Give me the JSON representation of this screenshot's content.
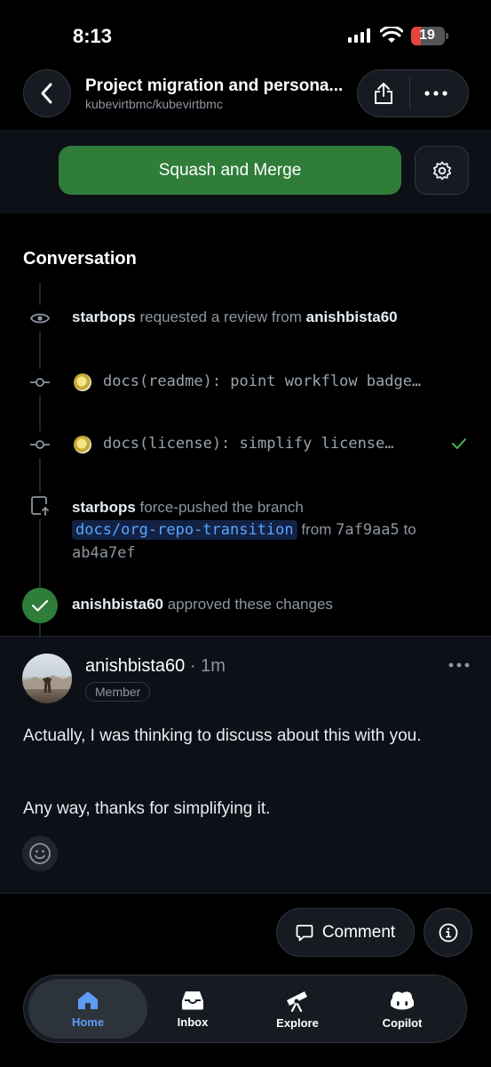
{
  "status_bar": {
    "time": "8:13",
    "battery": "19"
  },
  "header": {
    "title": "Project migration and persona...",
    "subtitle": "kubevirtbmc/kubevirtbmc"
  },
  "merge": {
    "button_label": "Squash and Merge"
  },
  "conversation": {
    "title": "Conversation",
    "review_request": {
      "actor": "starbops",
      "action": " requested a review from ",
      "target": "anishbista60"
    },
    "commits": [
      {
        "message": "docs(readme): point workflow badge…"
      },
      {
        "message": "docs(license): simplify license…"
      }
    ],
    "force_push": {
      "actor": "starbops",
      "action": " force-pushed the branch",
      "branch": "docs/org-repo-transition",
      "from_word": "from",
      "from_sha": "7af9aa5",
      "to_word": "to",
      "to_sha": "ab4a7ef"
    },
    "approval": {
      "actor": "anishbista60",
      "action": " approved these changes"
    }
  },
  "comment": {
    "author": "anishbista60",
    "time": " · 1m",
    "badge": "Member",
    "paragraphs": [
      "Actually, I was thinking to discuss about this with you.",
      "Any way, thanks for simplifying it."
    ]
  },
  "footer": {
    "comment_label": "Comment"
  },
  "tabs": [
    {
      "label": "Home",
      "icon": "home-icon",
      "active": true
    },
    {
      "label": "Inbox",
      "icon": "inbox-icon"
    },
    {
      "label": "Explore",
      "icon": "telescope-icon"
    },
    {
      "label": "Copilot",
      "icon": "copilot-icon"
    }
  ],
  "colors": {
    "merge": "#2f7d39",
    "accent": "#5d9df8",
    "success": "#3fb950"
  }
}
